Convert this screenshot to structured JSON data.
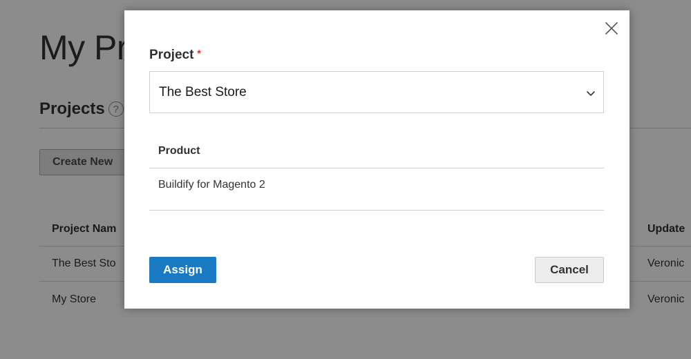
{
  "background": {
    "page_title": "My Pr",
    "section_title": "Projects",
    "help_glyph": "?",
    "create_button_label": "Create New",
    "grid": {
      "headers": {
        "name": "Project Nam",
        "updated": "Update"
      },
      "rows": [
        {
          "name": "The Best Sto",
          "updated": "Veronic"
        },
        {
          "name": "My Store",
          "updated": "Veronic"
        }
      ]
    }
  },
  "modal": {
    "close_icon": "close-icon",
    "project_field": {
      "label": "Project",
      "required_mark": "*",
      "selected_value": "The Best Store",
      "dropdown_icon": "chevron-down-icon"
    },
    "product_table": {
      "header": "Product",
      "rows": [
        "Buildify for Magento 2"
      ]
    },
    "assign_label": "Assign",
    "cancel_label": "Cancel"
  },
  "colors": {
    "primary_button": "#1979c3",
    "required": "#e22626",
    "overlay": "rgba(0,0,0,0.45)"
  }
}
